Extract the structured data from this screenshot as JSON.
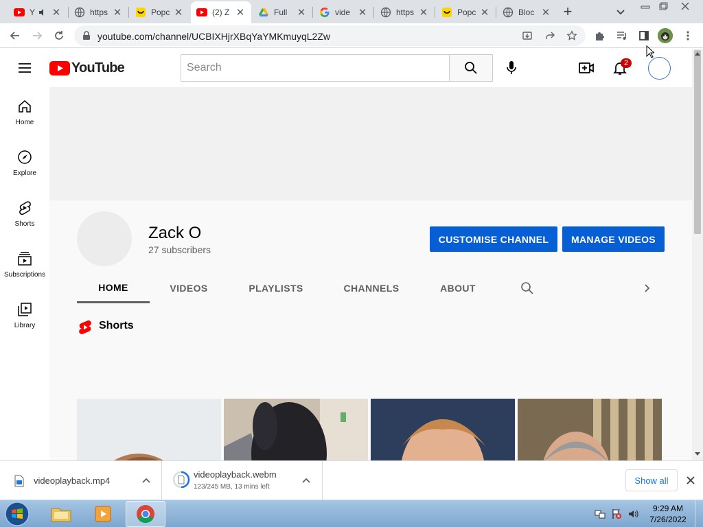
{
  "browser": {
    "tabs": [
      {
        "title": "Y",
        "favicon": "youtube-icon",
        "muted": true
      },
      {
        "title": "https",
        "favicon": "globe-icon"
      },
      {
        "title": "Popc",
        "favicon": "popcorn-icon"
      },
      {
        "title": "(2) Z",
        "favicon": "youtube-icon",
        "active": true
      },
      {
        "title": "Full",
        "favicon": "google-drive-icon"
      },
      {
        "title": "vide",
        "favicon": "google-icon"
      },
      {
        "title": "https",
        "favicon": "globe-icon"
      },
      {
        "title": "Popc",
        "favicon": "popcorn-icon"
      },
      {
        "title": "Bloc",
        "favicon": "globe-icon"
      }
    ],
    "url": "youtube.com/channel/UCBIXHjrXBqYaYMKmuyqL2Zw"
  },
  "youtube": {
    "logo_text": "YouTube",
    "search_placeholder": "Search",
    "notification_count": "2",
    "guide": [
      {
        "label": "Home",
        "icon": "home-icon"
      },
      {
        "label": "Explore",
        "icon": "compass-icon"
      },
      {
        "label": "Shorts",
        "icon": "shorts-icon"
      },
      {
        "label": "Subscriptions",
        "icon": "subscriptions-icon"
      },
      {
        "label": "Library",
        "icon": "library-icon"
      }
    ],
    "channel": {
      "name": "Zack O",
      "subscribers": "27 subscribers",
      "customise_label": "CUSTOMISE CHANNEL",
      "manage_label": "MANAGE VIDEOS",
      "tabs": [
        "HOME",
        "VIDEOS",
        "PLAYLISTS",
        "CHANNELS",
        "ABOUT"
      ],
      "selected_tab": "HOME"
    },
    "shelf_title": "Shorts"
  },
  "downloads": {
    "items": [
      {
        "name": "videoplayback.mp4",
        "status": ""
      },
      {
        "name": "videoplayback.webm",
        "status": "123/245 MB, 13 mins left"
      }
    ],
    "show_all": "Show all"
  },
  "taskbar": {
    "time": "9:29 AM",
    "date": "7/26/2022"
  }
}
